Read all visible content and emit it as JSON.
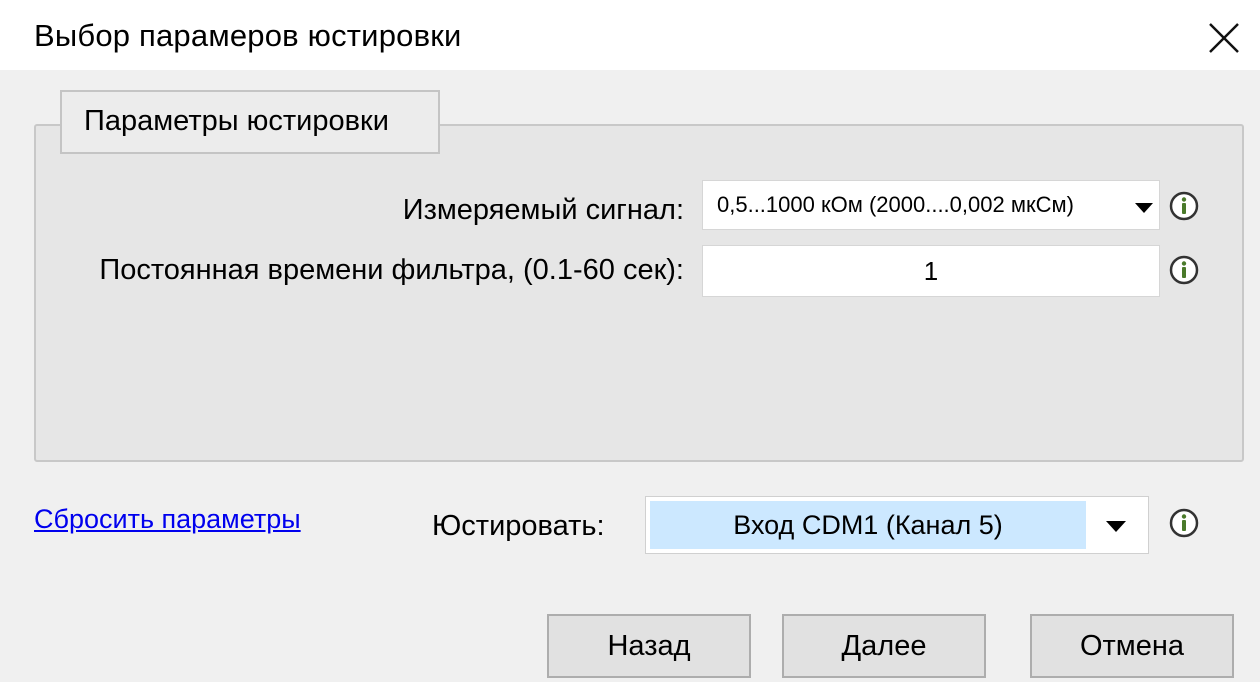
{
  "window": {
    "title": "Выбор парамеров юстировки"
  },
  "group": {
    "caption": "Параметры юстировки",
    "signal_label": "Измеряемый сигнал:",
    "signal_value": "0,5...1000 кОм (2000....0,002 мкСм)",
    "filter_label": "Постоянная времени фильтра, (0.1-60 сек):",
    "filter_value": "1"
  },
  "reset_link": "Сбросить параметры",
  "adjust": {
    "label": "Юстировать:",
    "value": "Вход CDM1 (Канал 5)"
  },
  "buttons": {
    "back": "Назад",
    "next": "Далее",
    "cancel": "Отмена"
  },
  "icons": {
    "info": "info-icon",
    "close": "close-icon",
    "dropdown": "chevron-down-icon"
  },
  "colors": {
    "link": "#0000ee",
    "selection": "#cce8ff",
    "info_icon": "#4a7a2a"
  }
}
